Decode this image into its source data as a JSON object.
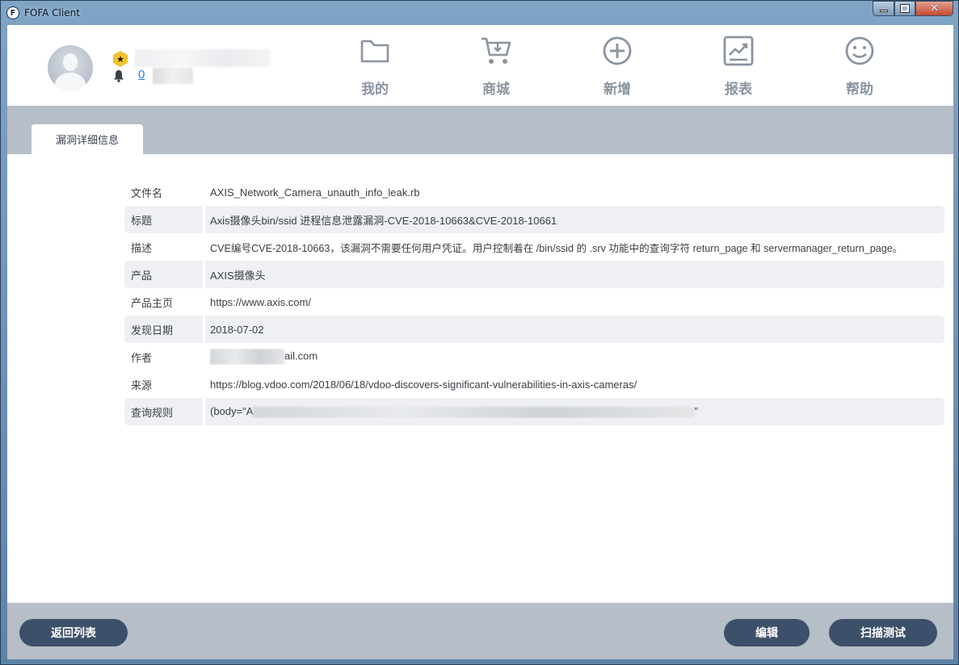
{
  "window": {
    "title": "FOFA Client",
    "app_icon_letter": "F",
    "minimize_icon": "minimize-icon",
    "maximize_icon": "maximize-icon",
    "close_icon": "close-icon",
    "close_glyph": "✕"
  },
  "user": {
    "level_icon": "star-icon",
    "level_glyph": "★",
    "notice_count": "0"
  },
  "nav": [
    {
      "label": "我的",
      "icon": "folder-icon"
    },
    {
      "label": "商城",
      "icon": "cart-icon"
    },
    {
      "label": "新增",
      "icon": "plus-circle-icon"
    },
    {
      "label": "报表",
      "icon": "chart-icon"
    },
    {
      "label": "帮助",
      "icon": "smiley-icon"
    }
  ],
  "tab": {
    "label": "漏洞详细信息"
  },
  "details": [
    {
      "key": "文件名",
      "value": "AXIS_Network_Camera_unauth_info_leak.rb"
    },
    {
      "key": "标题",
      "value": "Axis摄像头bin/ssid 进程信息泄露漏洞-CVE-2018-10663&CVE-2018-10661"
    },
    {
      "key": "描述",
      "value": "CVE编号CVE-2018-10663，该漏洞不需要任何用户凭证。用户控制着在 /bin/ssid 的 .srv 功能中的查询字符 return_page 和 servermanager_return_page。"
    },
    {
      "key": "产品",
      "value": "AXIS摄像头"
    },
    {
      "key": "产品主页",
      "value": "https://www.axis.com/"
    },
    {
      "key": "发现日期",
      "value": "2018-07-02"
    },
    {
      "key": "作者",
      "value": "ail.com"
    },
    {
      "key": "来源",
      "value": "https://blog.vdoo.com/2018/06/18/vdoo-discovers-significant-vulnerabilities-in-axis-cameras/"
    },
    {
      "key": "查询规则",
      "value_prefix": "(body=\"A",
      "value_suffix": "\""
    }
  ],
  "buttons": {
    "back": "返回列表",
    "edit": "编辑",
    "scan": "扫描测试"
  },
  "colors": {
    "button_bg": "#3d5069",
    "strip_bg": "#b6bec8",
    "nav_text": "#8a94a0",
    "link": "#2a7be0"
  }
}
